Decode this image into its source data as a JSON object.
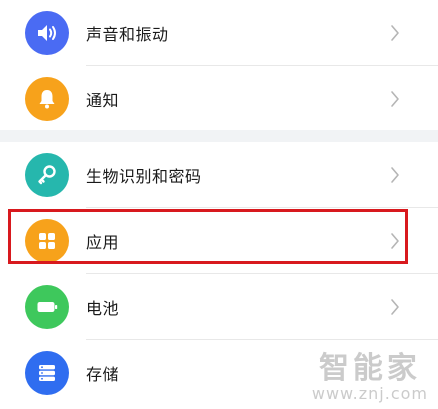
{
  "settings": {
    "items": [
      {
        "label": "声音和振动",
        "icon": "speaker-icon",
        "color": "#4a6bf3"
      },
      {
        "label": "通知",
        "icon": "bell-icon",
        "color": "#f7a21b"
      },
      {
        "label": "生物识别和密码",
        "icon": "key-icon",
        "color": "#26b7ad"
      },
      {
        "label": "应用",
        "icon": "apps-grid-icon",
        "color": "#f7a21b"
      },
      {
        "label": "电池",
        "icon": "battery-icon",
        "color": "#3ec85c"
      },
      {
        "label": "存储",
        "icon": "storage-icon",
        "color": "#2f6df0"
      }
    ]
  },
  "highlight": {
    "color": "#d8191e",
    "target": "应用"
  },
  "watermark": {
    "text": "智能家",
    "url": "www.znj.com"
  }
}
